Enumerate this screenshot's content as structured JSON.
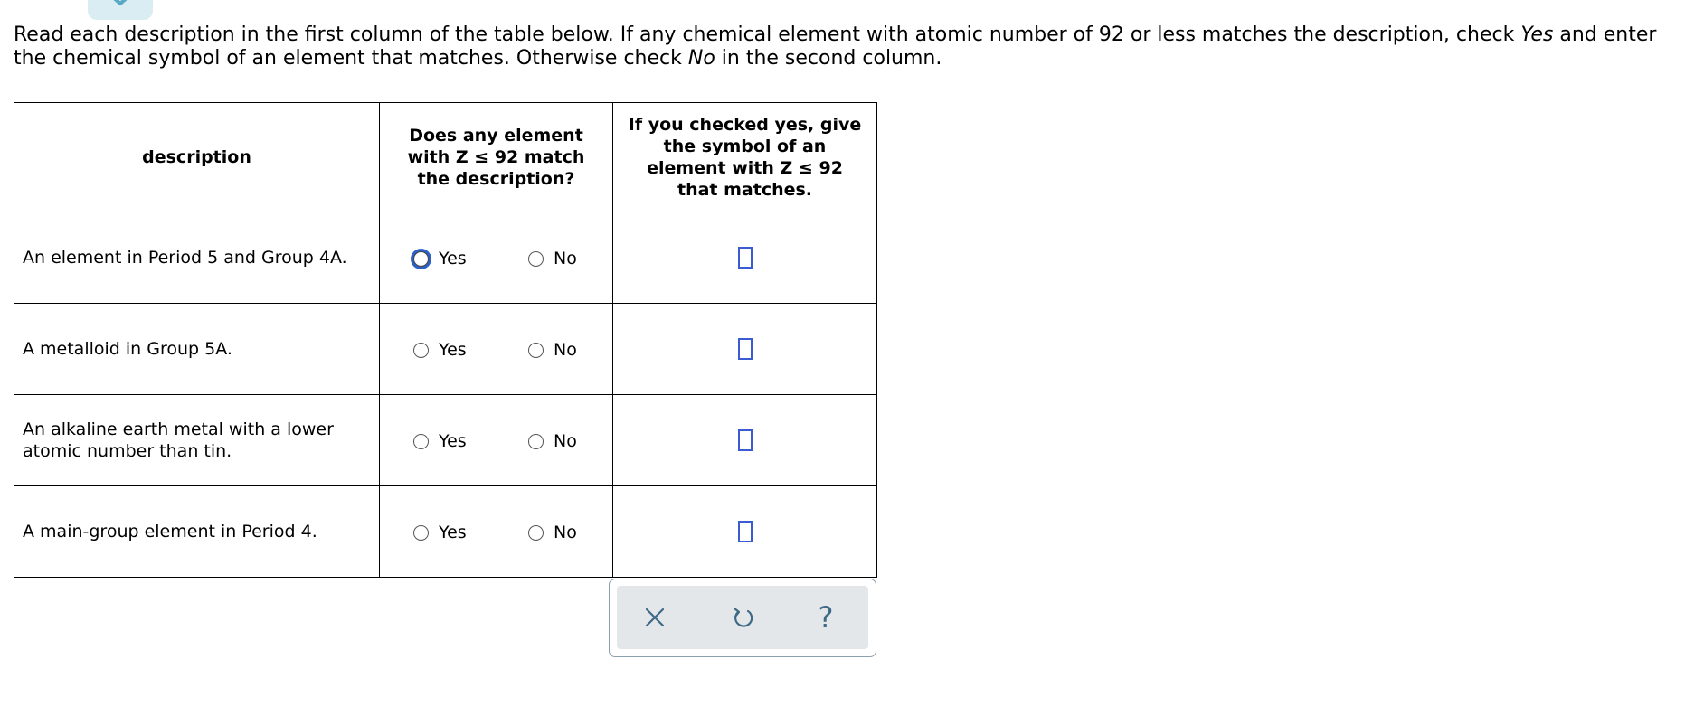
{
  "instructions": {
    "part1": "Read each description in the first column of the table below. If any chemical element with atomic number of 92 or less matches the description, check ",
    "yes_word": "Yes",
    "part2": " and enter the chemical symbol of an element that matches. Otherwise check ",
    "no_word": "No",
    "part3": " in the second column."
  },
  "table": {
    "headers": {
      "description": "description",
      "match_line1": "Does any element",
      "match_line2": "with Z ≤ 92 match",
      "match_line3": "the description?",
      "symbol_line1": "If you checked yes, give",
      "symbol_line2": "the symbol of an",
      "symbol_line3": "element with Z ≤ 92",
      "symbol_line4": "that matches."
    },
    "rows": [
      {
        "description": "An element in Period 5 and Group 4A.",
        "yes_label": "Yes",
        "no_label": "No",
        "symbol_value": ""
      },
      {
        "description": "A metalloid in Group 5A.",
        "yes_label": "Yes",
        "no_label": "No",
        "symbol_value": ""
      },
      {
        "description": "An alkaline earth metal with a lower atomic number than tin.",
        "yes_label": "Yes",
        "no_label": "No",
        "symbol_value": ""
      },
      {
        "description": "A main-group element in Period 4.",
        "yes_label": "Yes",
        "no_label": "No",
        "symbol_value": ""
      }
    ]
  },
  "toolbar": {
    "clear_icon": "x-icon",
    "undo_icon": "undo-icon",
    "help_label": "?"
  },
  "colors": {
    "focus_ring": "#2b61c6",
    "answer_box_border": "#3b5bd1",
    "toolbar_icon": "#3e6a86",
    "top_tab": "#d9edf3"
  }
}
